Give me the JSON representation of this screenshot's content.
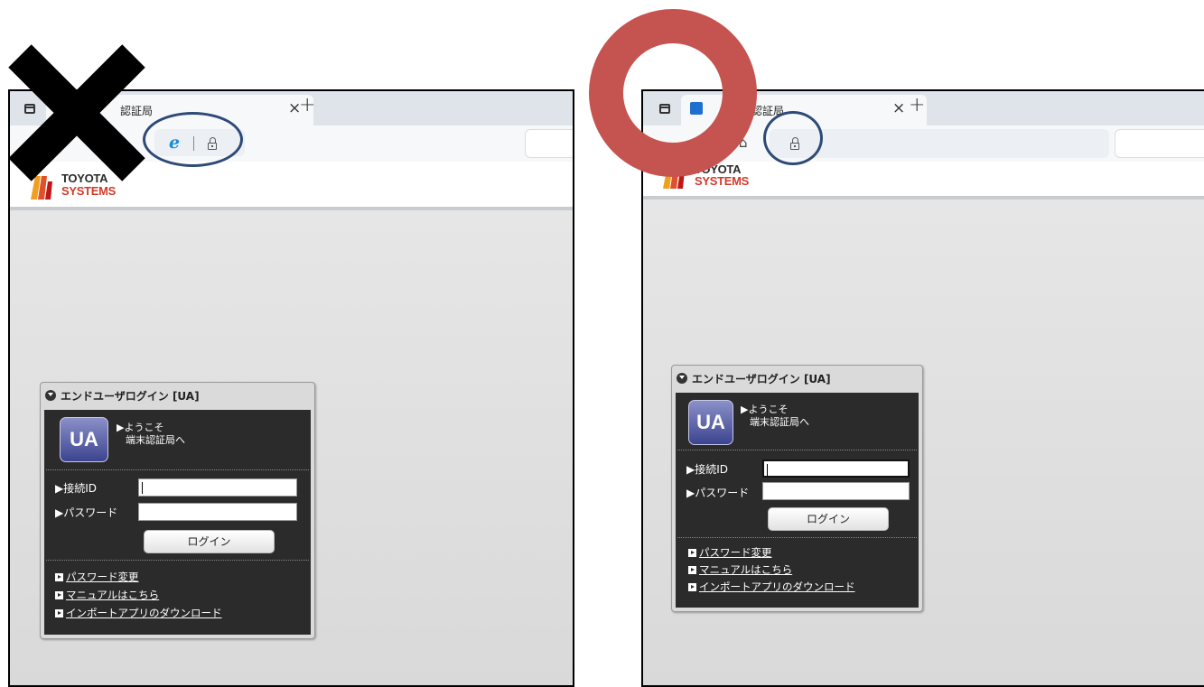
{
  "left": {
    "verdict": "x",
    "tab": {
      "title": "認証局",
      "close": "×"
    },
    "new_tab": "+",
    "logo": {
      "line1": "TOYOTA",
      "line2": "SYSTEMS"
    },
    "login": {
      "title": "エンドユーザログイン [UA]",
      "badge": "UA",
      "welcome": [
        "▶ようこそ",
        "端末認証局へ"
      ],
      "id_label": "▶接続ID",
      "password_label": "▶パスワード",
      "button": "ログイン",
      "links": [
        "パスワード変更",
        "マニュアルはこちら",
        "インポートアプリのダウンロード"
      ]
    }
  },
  "right": {
    "verdict": "o",
    "tab": {
      "title": "認証局",
      "close": "×"
    },
    "new_tab": "+",
    "logo": {
      "line1": "TOYOTA",
      "line2": "SYSTEMS"
    },
    "login": {
      "title": "エンドユーザログイン [UA]",
      "badge": "UA",
      "welcome": [
        "▶ようこそ",
        "端末認証局へ"
      ],
      "id_label": "▶接続ID",
      "password_label": "▶パスワード",
      "button": "ログイン",
      "links": [
        "パスワード変更",
        "マニュアルはこちら",
        "インポートアプリのダウンロード"
      ]
    }
  },
  "colors": {
    "ring": "#2d4a78",
    "circle_mark": "#c55350",
    "x_mark": "#000000"
  }
}
